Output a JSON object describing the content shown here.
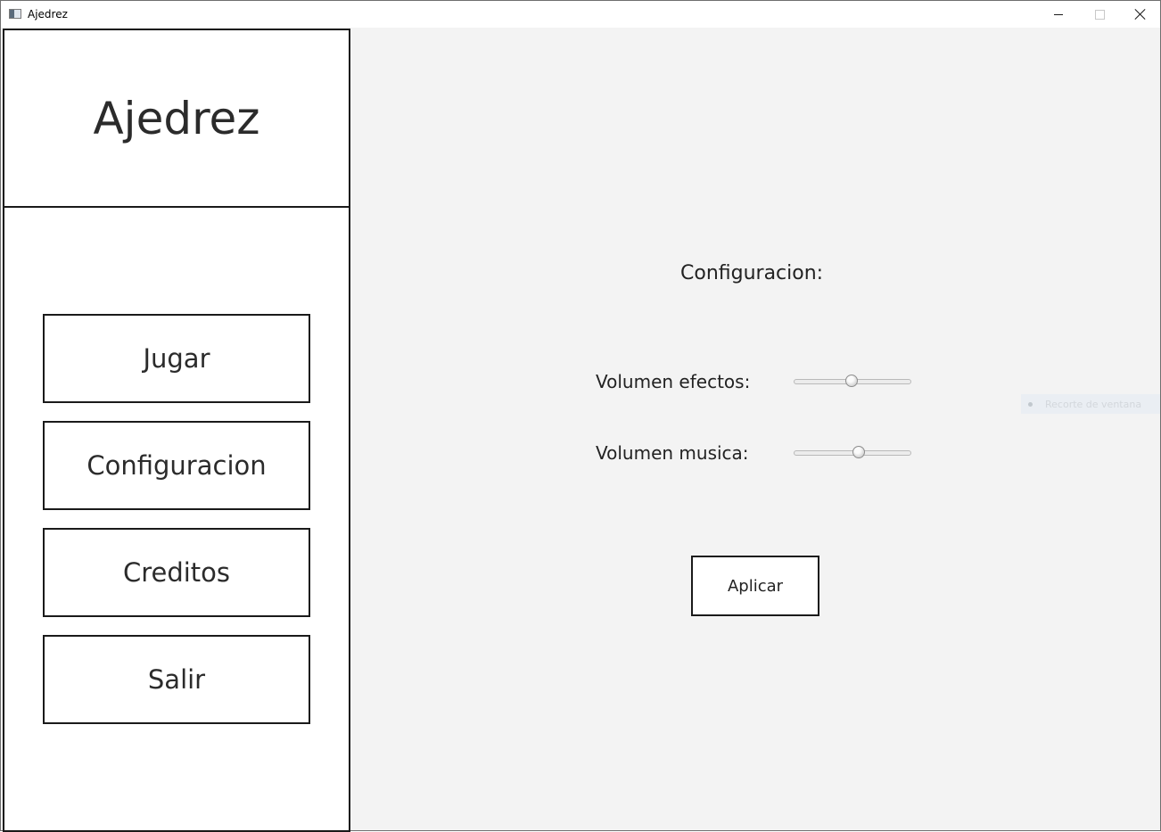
{
  "window": {
    "title": "Ajedrez"
  },
  "sidebar": {
    "logo": "Ajedrez",
    "menu": [
      {
        "label": "Jugar"
      },
      {
        "label": "Configuracion"
      },
      {
        "label": "Creditos"
      },
      {
        "label": "Salir"
      }
    ]
  },
  "settings": {
    "title": "Configuracion:",
    "effects_label": "Volumen efectos:",
    "effects_value": 0.5,
    "music_label": "Volumen musica:",
    "music_value": 0.56,
    "apply_label": "Aplicar"
  },
  "overlay": {
    "text": "Recorte de ventana"
  },
  "icons": {
    "app": "app-window-icon",
    "minimize": "minimize-icon",
    "maximize": "maximize-icon",
    "close": "close-icon"
  }
}
